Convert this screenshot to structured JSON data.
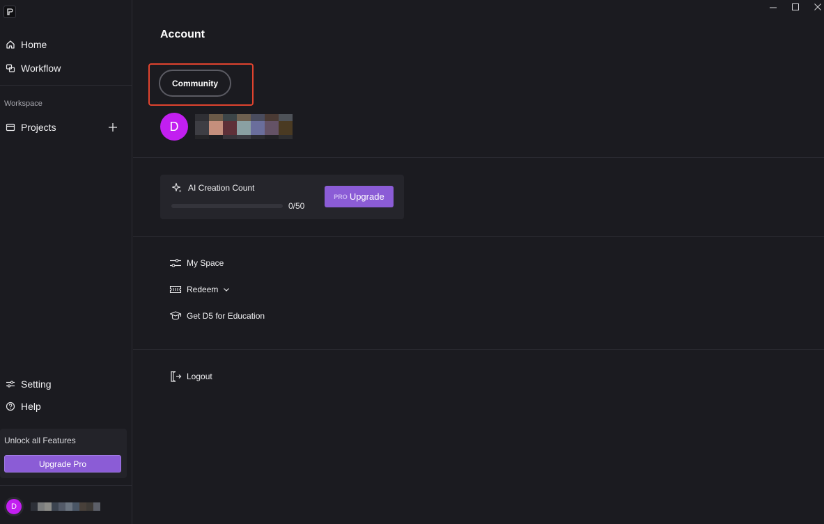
{
  "sidebar": {
    "nav": [
      {
        "label": "Home",
        "icon": "home-icon"
      },
      {
        "label": "Workflow",
        "icon": "workflow-icon"
      }
    ],
    "workspace_label": "Workspace",
    "projects_label": "Projects",
    "setting_label": "Setting",
    "help_label": "Help",
    "unlock_title": "Unlock all Features",
    "upgrade_pro_label": "Upgrade Pro",
    "user_initial": "D"
  },
  "main": {
    "title": "Account",
    "community_label": "Community",
    "avatar_initial": "D",
    "ai_card": {
      "label": "AI Creation Count",
      "count": "0/50",
      "used": 0,
      "limit": 50,
      "pro_badge": "PRO",
      "upgrade_label": "Upgrade"
    },
    "menu": {
      "my_space": "My Space",
      "redeem": "Redeem",
      "education": "Get D5 for Education",
      "logout": "Logout"
    }
  },
  "colors": {
    "background": "#1b1b20",
    "accent": "#8b5cd6",
    "avatar": "#c21ff0",
    "highlight": "#e0432e"
  }
}
